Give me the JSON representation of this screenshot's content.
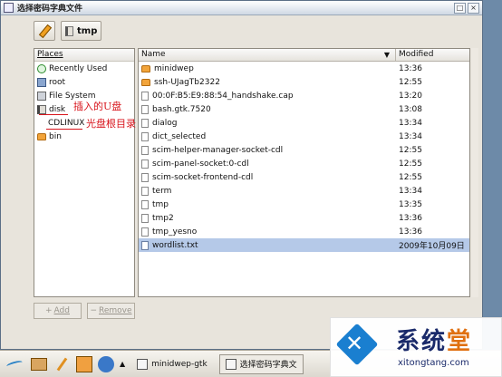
{
  "window": {
    "title": "选择密码字典文件",
    "controls": [
      "□",
      "×"
    ]
  },
  "path": {
    "current": "tmp"
  },
  "places": {
    "header": "Places",
    "items": [
      {
        "label": "Recently Used",
        "icon": "recent-icon"
      },
      {
        "label": "root",
        "icon": "home-icon"
      },
      {
        "label": "File System",
        "icon": "filesystem-icon"
      },
      {
        "label": "disk",
        "icon": "drive-icon"
      },
      {
        "label": "CDLINUX",
        "icon": ""
      },
      {
        "label": "bin",
        "icon": "folder-icon"
      }
    ],
    "add_label": "Add",
    "remove_label": "Remove"
  },
  "annotations": {
    "usb": "插入的U盘",
    "cd": "光盘根目录"
  },
  "files": {
    "columns": {
      "name": "Name",
      "modified": "Modified",
      "sort_indicator": "▼"
    },
    "rows": [
      {
        "name": "minidwep",
        "modified": "13:36",
        "type": "folder"
      },
      {
        "name": "ssh-UJagTb2322",
        "modified": "12:55",
        "type": "folder"
      },
      {
        "name": "00:0F:B5:E9:88:54_handshake.cap",
        "modified": "13:20",
        "type": "file"
      },
      {
        "name": "bash.gtk.7520",
        "modified": "13:08",
        "type": "file"
      },
      {
        "name": "dialog",
        "modified": "13:34",
        "type": "file"
      },
      {
        "name": "dict_selected",
        "modified": "13:34",
        "type": "file"
      },
      {
        "name": "scim-helper-manager-socket-cdl",
        "modified": "12:55",
        "type": "file"
      },
      {
        "name": "scim-panel-socket:0-cdl",
        "modified": "12:55",
        "type": "file"
      },
      {
        "name": "scim-socket-frontend-cdl",
        "modified": "12:55",
        "type": "file"
      },
      {
        "name": "term",
        "modified": "13:34",
        "type": "file"
      },
      {
        "name": "tmp",
        "modified": "13:35",
        "type": "file"
      },
      {
        "name": "tmp2",
        "modified": "13:36",
        "type": "file"
      },
      {
        "name": "tmp_yesno",
        "modified": "13:36",
        "type": "file"
      },
      {
        "name": "wordlist.txt",
        "modified": "2009年10月09日",
        "type": "text",
        "selected": true
      }
    ]
  },
  "taskbar": {
    "tasks": [
      {
        "label": "minidwep-gtk",
        "active": false
      },
      {
        "label": "选择密码字典文",
        "active": true
      }
    ]
  },
  "watermark": {
    "title_a": "系统",
    "title_b": "堂",
    "url": "xitongtang.com"
  }
}
